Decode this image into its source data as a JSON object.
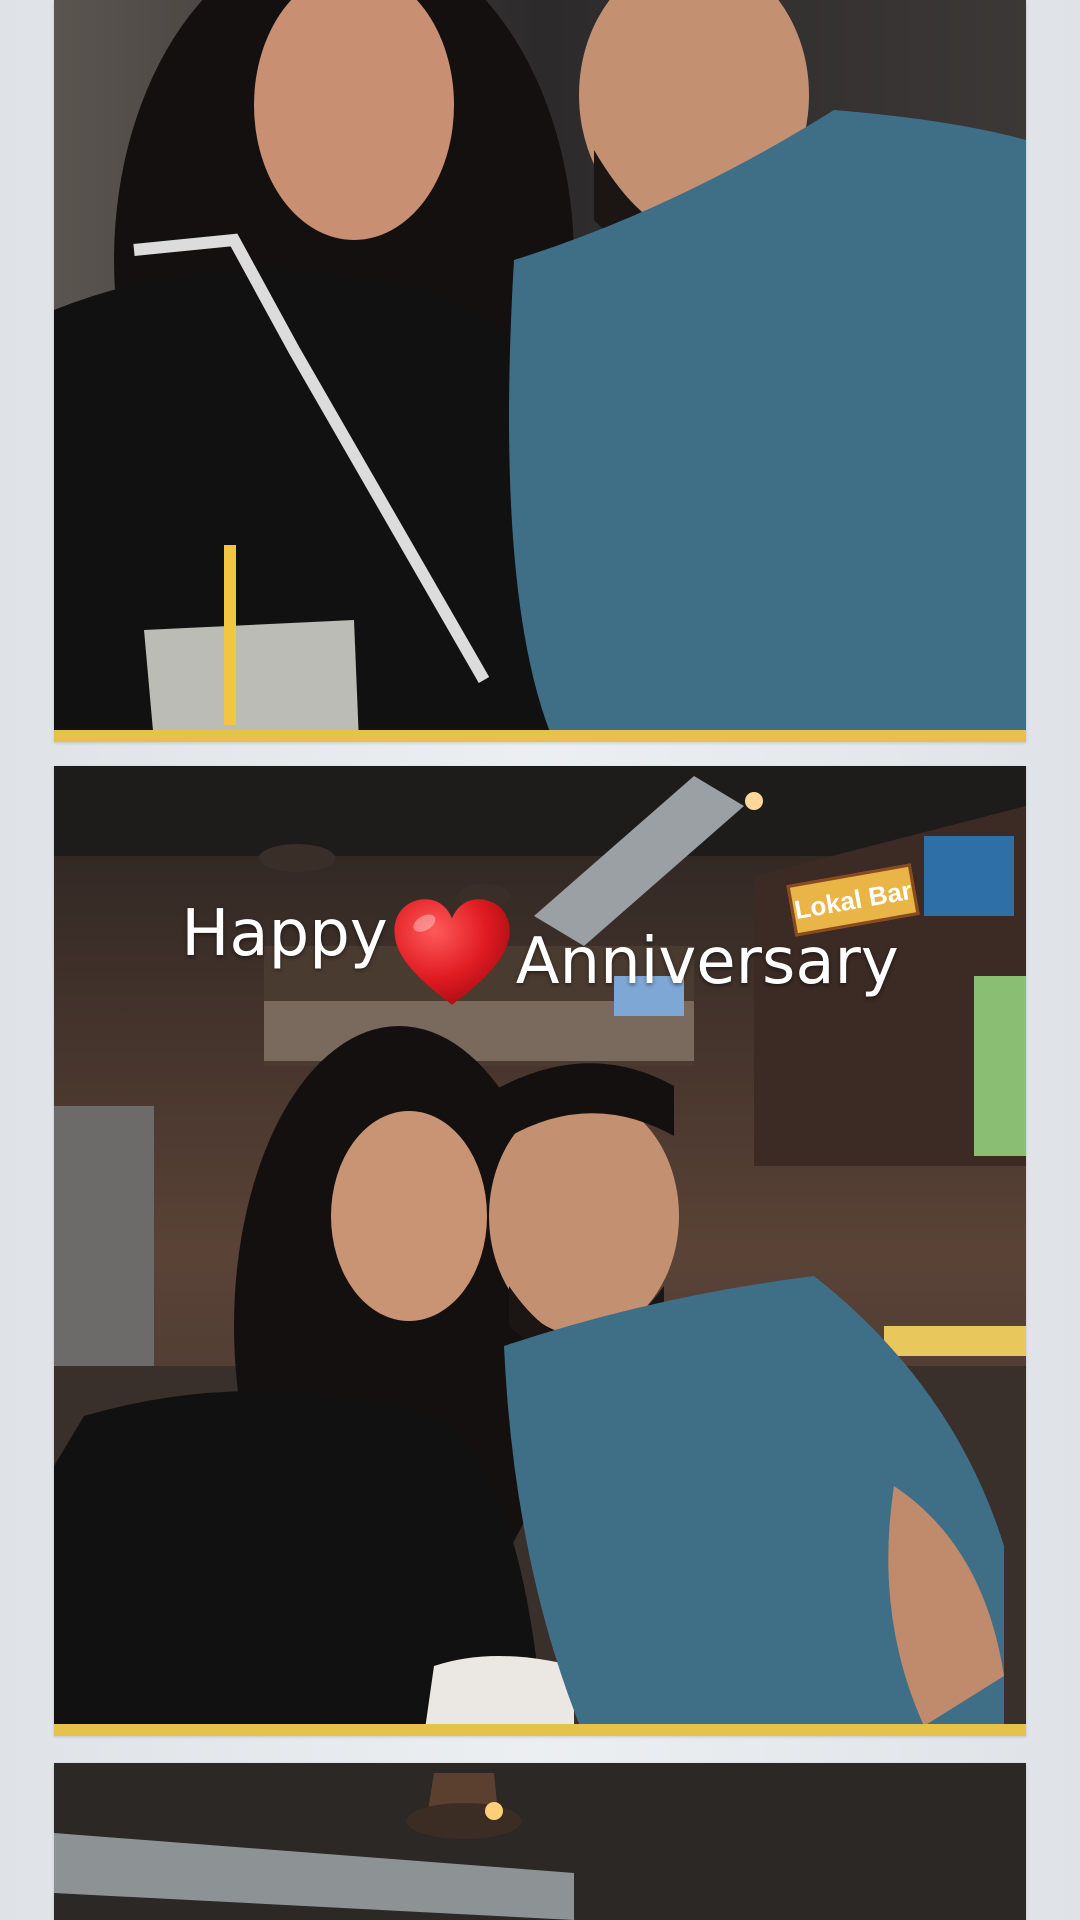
{
  "caption": {
    "word1": "Happy",
    "word2": "Anniversary",
    "heart": "heart-icon"
  },
  "sign": "Lokal Bar",
  "colors": {
    "background": "#e4e7ea",
    "caption_text": "#ffffff",
    "heart": "#d0141a",
    "frame_edge": "#e7c24a",
    "shirt": "#3f6f86"
  }
}
